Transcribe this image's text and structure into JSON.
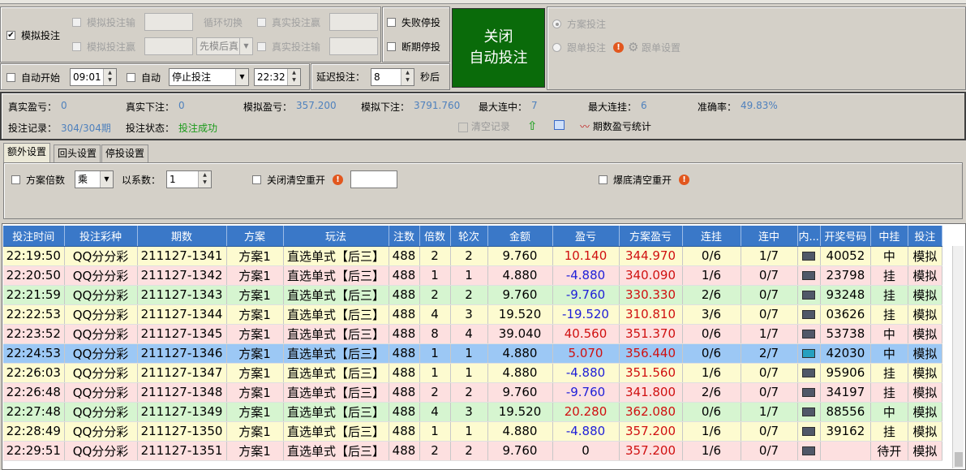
{
  "top_controls": {
    "sim_bet_label": "模拟投注",
    "sim_bet_input_label": "模拟投注输",
    "loop_switch_label": "循环切换",
    "real_bet_win_label": "真实投注赢",
    "sim_bet_win_label": "模拟投注赢",
    "order_select": "先模后真",
    "real_bet_lose_label": "真实投注输",
    "fail_stop_label": "失败停投",
    "period_stop_label": "断期停投",
    "close_auto_line1": "关闭",
    "close_auto_line2": "自动投注",
    "plan_bet_label": "方案投注",
    "follow_bet_label": "跟单投注",
    "follow_settings_label": "跟单设置"
  },
  "schedule": {
    "auto_start_label": "自动开始",
    "start_time": "09:01",
    "auto_label": "自动",
    "action_select": "停止投注",
    "end_time": "22:32",
    "delay_label": "延迟投注：",
    "delay_value": "8",
    "seconds_label": "秒后"
  },
  "stats": {
    "real_pl_label": "真实盈亏：",
    "real_pl": "0",
    "real_bet_label": "真实下注：",
    "real_bet": "0",
    "sim_pl_label": "模拟盈亏：",
    "sim_pl": "357.200",
    "sim_bet_label": "模拟下注：",
    "sim_bet": "3791.760",
    "max_win_label": "最大连中：",
    "max_win": "7",
    "max_lose_label": "最大连挂：",
    "max_lose": "6",
    "accuracy_label": "准确率：",
    "accuracy": "49.83%",
    "record_label": "投注记录：",
    "record": "304/304期",
    "status_label": "投注状态：",
    "status": "投注成功",
    "clear_label": "清空记录",
    "period_stats_label": "期数盈亏统计"
  },
  "tabs": [
    "额外设置",
    "回头设置",
    "停投设置"
  ],
  "extra": {
    "plan_multiple_label": "方案倍数",
    "op_select": "乘",
    "coef_label": "以系数：",
    "coef_value": "1",
    "close_reset_label": "关闭清空重开",
    "burst_reset_label": "爆底清空重开"
  },
  "colors": {
    "accent": "#3a78c8",
    "close_button": "#0a6b0a",
    "row_yellow": "#fdfbd0",
    "row_pink": "#fde0e0",
    "row_green": "#d6f5d0",
    "row_selected": "#9cc8f5",
    "positive": "#d01010",
    "negative": "#2020d8"
  },
  "table": {
    "headers": [
      "投注时间",
      "投注彩种",
      "期数",
      "方案",
      "玩法",
      "注数",
      "倍数",
      "轮次",
      "金额",
      "盈亏",
      "方案盈亏",
      "连挂",
      "连中",
      "内...",
      "开奖号码",
      "中挂",
      "投注"
    ],
    "rows": [
      {
        "time": "22:19:50",
        "lottery": "QQ分分彩",
        "period": "211127-1341",
        "plan": "方案1",
        "play": "直选单式【后三】",
        "notes": "488",
        "mult": "2",
        "round": "2",
        "amount": "9.760",
        "pl": "10.140",
        "plan_pl": "344.970",
        "lose": "0/6",
        "win": "1/7",
        "content": "",
        "number": "40052",
        "result": "中",
        "bet": "模拟",
        "color": "yellow"
      },
      {
        "time": "22:20:50",
        "lottery": "QQ分分彩",
        "period": "211127-1342",
        "plan": "方案1",
        "play": "直选单式【后三】",
        "notes": "488",
        "mult": "1",
        "round": "1",
        "amount": "4.880",
        "pl": "-4.880",
        "plan_pl": "340.090",
        "lose": "1/6",
        "win": "0/7",
        "content": "",
        "number": "23798",
        "result": "挂",
        "bet": "模拟",
        "color": "pink"
      },
      {
        "time": "22:21:59",
        "lottery": "QQ分分彩",
        "period": "211127-1343",
        "plan": "方案1",
        "play": "直选单式【后三】",
        "notes": "488",
        "mult": "2",
        "round": "2",
        "amount": "9.760",
        "pl": "-9.760",
        "plan_pl": "330.330",
        "lose": "2/6",
        "win": "0/7",
        "content": "",
        "number": "93248",
        "result": "挂",
        "bet": "模拟",
        "color": "green"
      },
      {
        "time": "22:22:53",
        "lottery": "QQ分分彩",
        "period": "211127-1344",
        "plan": "方案1",
        "play": "直选单式【后三】",
        "notes": "488",
        "mult": "4",
        "round": "3",
        "amount": "19.520",
        "pl": "-19.520",
        "plan_pl": "310.810",
        "lose": "3/6",
        "win": "0/7",
        "content": "",
        "number": "03626",
        "result": "挂",
        "bet": "模拟",
        "color": "yellow"
      },
      {
        "time": "22:23:52",
        "lottery": "QQ分分彩",
        "period": "211127-1345",
        "plan": "方案1",
        "play": "直选单式【后三】",
        "notes": "488",
        "mult": "8",
        "round": "4",
        "amount": "39.040",
        "pl": "40.560",
        "plan_pl": "351.370",
        "lose": "0/6",
        "win": "1/7",
        "content": "",
        "number": "53738",
        "result": "中",
        "bet": "模拟",
        "color": "pink"
      },
      {
        "time": "22:24:53",
        "lottery": "QQ分分彩",
        "period": "211127-1346",
        "plan": "方案1",
        "play": "直选单式【后三】",
        "notes": "488",
        "mult": "1",
        "round": "1",
        "amount": "4.880",
        "pl": "5.070",
        "plan_pl": "356.440",
        "lose": "0/6",
        "win": "2/7",
        "content": "",
        "number": "42030",
        "result": "中",
        "bet": "模拟",
        "color": "selected"
      },
      {
        "time": "22:26:03",
        "lottery": "QQ分分彩",
        "period": "211127-1347",
        "plan": "方案1",
        "play": "直选单式【后三】",
        "notes": "488",
        "mult": "1",
        "round": "1",
        "amount": "4.880",
        "pl": "-4.880",
        "plan_pl": "351.560",
        "lose": "1/6",
        "win": "0/7",
        "content": "",
        "number": "95906",
        "result": "挂",
        "bet": "模拟",
        "color": "yellow"
      },
      {
        "time": "22:26:48",
        "lottery": "QQ分分彩",
        "period": "211127-1348",
        "plan": "方案1",
        "play": "直选单式【后三】",
        "notes": "488",
        "mult": "2",
        "round": "2",
        "amount": "9.760",
        "pl": "-9.760",
        "plan_pl": "341.800",
        "lose": "2/6",
        "win": "0/7",
        "content": "",
        "number": "34197",
        "result": "挂",
        "bet": "模拟",
        "color": "pink"
      },
      {
        "time": "22:27:48",
        "lottery": "QQ分分彩",
        "period": "211127-1349",
        "plan": "方案1",
        "play": "直选单式【后三】",
        "notes": "488",
        "mult": "4",
        "round": "3",
        "amount": "19.520",
        "pl": "20.280",
        "plan_pl": "362.080",
        "lose": "0/6",
        "win": "1/7",
        "content": "",
        "number": "88556",
        "result": "中",
        "bet": "模拟",
        "color": "green"
      },
      {
        "time": "22:28:49",
        "lottery": "QQ分分彩",
        "period": "211127-1350",
        "plan": "方案1",
        "play": "直选单式【后三】",
        "notes": "488",
        "mult": "1",
        "round": "1",
        "amount": "4.880",
        "pl": "-4.880",
        "plan_pl": "357.200",
        "lose": "1/6",
        "win": "0/7",
        "content": "",
        "number": "39162",
        "result": "挂",
        "bet": "模拟",
        "color": "yellow"
      },
      {
        "time": "22:29:51",
        "lottery": "QQ分分彩",
        "period": "211127-1351",
        "plan": "方案1",
        "play": "直选单式【后三】",
        "notes": "488",
        "mult": "2",
        "round": "2",
        "amount": "9.760",
        "pl": "0",
        "plan_pl": "357.200",
        "lose": "1/6",
        "win": "0/7",
        "content": "",
        "number": "",
        "result": "待开",
        "bet": "模拟",
        "color": "pink"
      }
    ]
  }
}
